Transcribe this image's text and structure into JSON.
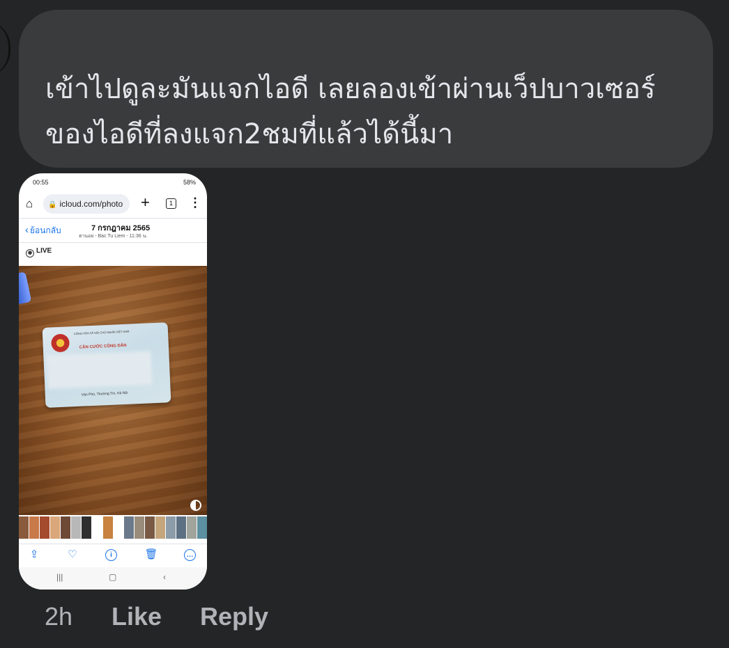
{
  "comment": {
    "line1": "เข้าไปดูละมันแจกไอดี เลยลองเข้าผ่านเว็ปบาวเซอร์",
    "line2": "ของไอดีที่ลงแจก2ชมที่แล้วได้นี้มา"
  },
  "screenshot": {
    "status": {
      "time": "00:55",
      "battery": "58%"
    },
    "browser": {
      "url": "icloud.com/photo",
      "tab_count": "1"
    },
    "photo_header": {
      "back_label": "ย้อนกลับ",
      "date": "7 กรกฎาคม 2565",
      "location": "ฮานอย - Bac Tu Liem - 11:36 น."
    },
    "live_label": "LIVE",
    "card": {
      "header": "CỘNG HÒA XÃ HỘI CHỦ NGHĨA VIỆT NAM",
      "title": "CĂN CƯỚC CÔNG DÂN",
      "address": "Văn Phú, Thường Tín, Hà Nội"
    },
    "thumbnail_colors": [
      "#8a5a3d",
      "#c97a4a",
      "#a44b2e",
      "#d9a77a",
      "#6e4a36",
      "#b8b8b8",
      "#2f2f2f",
      "#ffffff",
      "#c7833f",
      "#ffffff",
      "#6b7a8a",
      "#9a8c7a",
      "#7a5a45",
      "#c4a57c",
      "#8c9ca8",
      "#5d7183",
      "#a0a49a",
      "#5c8f9f"
    ]
  },
  "actions": {
    "age": "2h",
    "like": "Like",
    "reply": "Reply"
  },
  "colors": {
    "background": "#242526",
    "bubble": "#3a3b3c",
    "link_blue": "#1a73e8"
  }
}
